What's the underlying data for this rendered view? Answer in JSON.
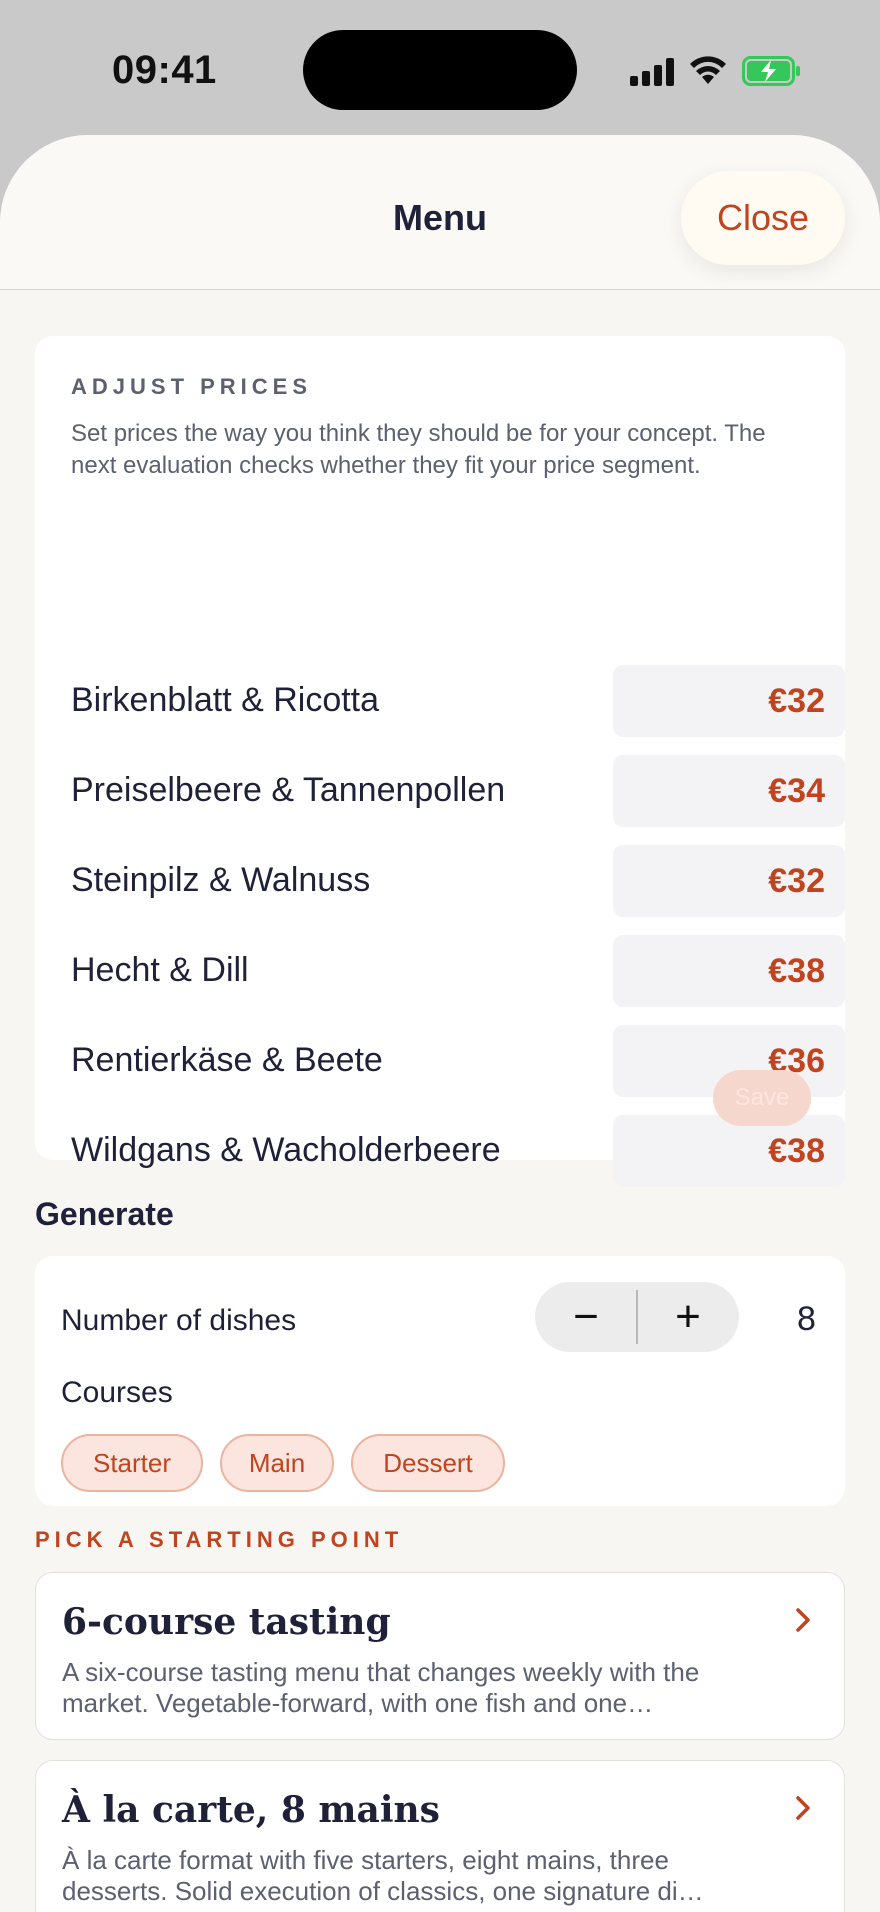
{
  "status_bar": {
    "time": "09:41"
  },
  "header": {
    "title": "Menu",
    "close_label": "Close"
  },
  "adjust_prices": {
    "heading": "ADJUST PRICES",
    "description": "Set prices the way you think they should be for your concept. The next evaluation checks whether they fit your price segment.",
    "items": [
      {
        "name": "Birkenblatt & Ricotta",
        "price": "€32"
      },
      {
        "name": "Preiselbeere & Tannenpollen",
        "price": "€34"
      },
      {
        "name": "Steinpilz & Walnuss",
        "price": "€32"
      },
      {
        "name": "Hecht & Dill",
        "price": "€38"
      },
      {
        "name": "Rentierkäse & Beete",
        "price": "€36"
      },
      {
        "name": "Wildgans & Wacholderbeere",
        "price": "€38"
      }
    ],
    "save_label": "Save"
  },
  "generate": {
    "title": "Generate",
    "dishes_label": "Number of dishes",
    "minus_label": "−",
    "plus_label": "+",
    "dish_count": "8",
    "courses_label": "Courses",
    "courses": [
      "Starter",
      "Main",
      "Dessert"
    ]
  },
  "starting_point": {
    "heading": "PICK A STARTING POINT",
    "options": [
      {
        "title": "6-course tasting",
        "description": "A six-course tasting menu that changes weekly with the market. Vegetable-forward, with one fish and one…"
      },
      {
        "title": "À la carte, 8 mains",
        "description": "À la carte format with five starters, eight mains, three desserts. Solid execution of classics, one signature di…"
      }
    ]
  },
  "colors": {
    "accent": "#c0441f",
    "text": "#1f2138",
    "muted": "#5c6070",
    "sheet_bg": "#f7f6f3"
  }
}
